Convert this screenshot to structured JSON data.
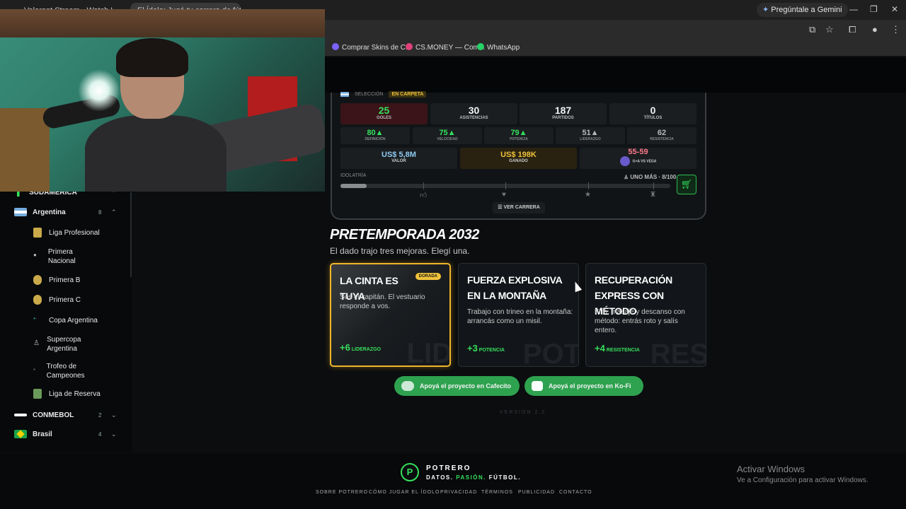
{
  "browser": {
    "tabs": [
      {
        "label": "Valorant Stream - Watch L..."
      },
      {
        "label": "El Ídolo: Jugá tu carrera de fútbol"
      }
    ],
    "gemini_label": "Pregúntale a Gemini",
    "bookmarks": [
      {
        "label": "Comprar Skins de C...",
        "color": "#7b61ff"
      },
      {
        "label": "CS.MONEY — Com...",
        "color": "#e0407a"
      },
      {
        "label": "WhatsApp",
        "color": "#25d366"
      }
    ]
  },
  "sidebar": {
    "section": "SUDAMÉRICA",
    "argentina": {
      "label": "Argentina",
      "count": "8"
    },
    "leagues": [
      {
        "label": "Liga Profesional"
      },
      {
        "label": "Primera Nacional"
      },
      {
        "label": "Primera B"
      },
      {
        "label": "Primera C"
      },
      {
        "label": "Copa Argentina"
      },
      {
        "label": "Supercopa Argentina"
      },
      {
        "label": "Trofeo de Campeones"
      },
      {
        "label": "Liga de Reserva"
      }
    ],
    "conmebol": {
      "label": "CONMEBOL",
      "count": "2"
    },
    "brasil": {
      "label": "Brasil",
      "count": "4"
    }
  },
  "player": {
    "seleccion_label": "SELECCIÓN",
    "status_badge": "EN CARPETA",
    "stats": [
      {
        "value": "25",
        "label": "GOLES"
      },
      {
        "value": "30",
        "label": "ASISTENCIAS"
      },
      {
        "value": "187",
        "label": "PARTIDOS"
      },
      {
        "value": "0",
        "label": "TÍTULOS"
      }
    ],
    "attributes": [
      {
        "value": "80▲",
        "label": "DEFINICIÓN"
      },
      {
        "value": "75▲",
        "label": "VELOCIDAD"
      },
      {
        "value": "79▲",
        "label": "POTENCIA"
      },
      {
        "value": "51▲",
        "label": "LIDERAZGO"
      },
      {
        "value": "62",
        "label": "RESISTENCIA"
      }
    ],
    "valor": {
      "value": "US$ 5,8M",
      "label": "VALOR"
    },
    "ganado": {
      "value": "US$ 198K",
      "label": "GANADO"
    },
    "record": {
      "value": "55-59",
      "label": "G+A VS VEGA"
    },
    "idolatria_label": "IDOLATRÍA",
    "idolatria_status": "UNO MÁS · 8/100",
    "idolatria_progress": 0.08,
    "ver_carrera": "VER CARRERA"
  },
  "pretemporada": {
    "title": "PRETEMPORADA 2032",
    "subtitle": "El dado trajo tres mejoras. Elegí una.",
    "cards": [
      {
        "title": "LA CINTA ES TUYA",
        "badge": "DORADA",
        "desc": "Sos el capitán. El vestuario responde a vos.",
        "bonus_value": "+6",
        "bonus_label": "LIDERAZGO",
        "watermark": "LID"
      },
      {
        "title": "FUERZA EXPLOSIVA EN LA MONTAÑA",
        "desc": "Trabajo con trineo en la montaña: arrancás como un misil.",
        "bonus_value": "+3",
        "bonus_label": "POTENCIA",
        "watermark": "POT"
      },
      {
        "title": "RECUPERACIÓN EXPRESS CON MÉTODO",
        "desc": "Frío, masaje y descanso con método: entrás roto y salís entero.",
        "bonus_value": "+4",
        "bonus_label": "RESISTENCIA",
        "watermark": "RES"
      }
    ]
  },
  "support": {
    "cafecito": "Apoyá el proyecto en Cafecito",
    "kofi": "Apoyá el proyecto en Ko-Fi"
  },
  "version": "VERSION 2.2",
  "footer": {
    "brand": "POTRERO",
    "tag_a": "DATOS.",
    "tag_b": "PASIÓN.",
    "tag_c": "FÚTBOL.",
    "links": [
      "SOBRE POTRERO",
      "CÓMO JUGAR EL ÍDOLO",
      "PRIVACIDAD",
      "TÉRMINOS",
      "PUBLICIDAD",
      "CONTACTO"
    ]
  },
  "windows": {
    "activar_title": "Activar Windows",
    "activar_sub": "Ve a Configuración para activar Windows."
  }
}
